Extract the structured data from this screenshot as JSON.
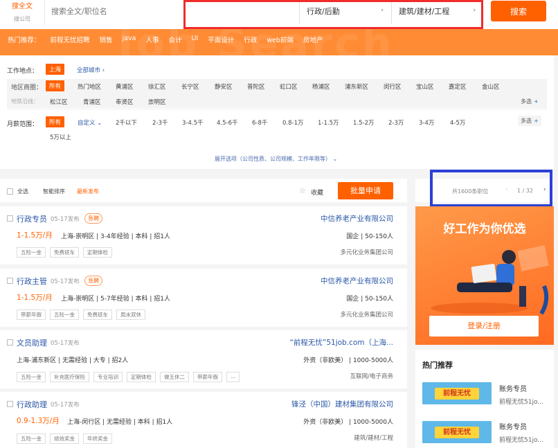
{
  "colors": {
    "accent": "#ff6000",
    "link": "#2b58a8",
    "highlight_red": "#ef2b2b",
    "highlight_blue": "#2b3fd6"
  },
  "search": {
    "type_active": "搜全文",
    "type_other": "搜公司",
    "placeholder": "搜索全文/职位名",
    "function_value": "行政/后勤",
    "industry_value": "建筑/建材/工程",
    "button": "搜索"
  },
  "hot": {
    "label": "热门推荐：",
    "items": [
      "前程无忧招聘",
      "销售",
      "java",
      "人事",
      "会计",
      "UI",
      "平面设计",
      "行政",
      "web前端",
      "房地产"
    ],
    "bg_text": "Job Search"
  },
  "filters": {
    "location_label": "工作地点：",
    "location_value": "上海",
    "all_cities": "全部城市",
    "area_label": "地区商圈：",
    "area_all": "所有",
    "areas_row1": [
      "热门地区",
      "黄浦区",
      "徐汇区",
      "长宁区",
      "静安区",
      "普陀区",
      "虹口区",
      "杨浦区",
      "浦东新区",
      "闵行区",
      "宝山区",
      "嘉定区",
      "金山区"
    ],
    "metro_label": "地铁沿线：",
    "areas_row2": [
      "松江区",
      "青浦区",
      "奉贤区",
      "崇明区"
    ],
    "multi": "多选",
    "salary_label": "月薪范围：",
    "salary_all": "所有",
    "salary_custom": "自定义",
    "salaries": [
      "2千以下",
      "2-3千",
      "3-4.5千",
      "4.5-6千",
      "6-8千",
      "0.8-1万",
      "1-1.5万",
      "1.5-2万",
      "2-3万",
      "3-4万",
      "4-5万"
    ],
    "salary_extra": "5万以上",
    "more": "展开选项（公司性质、公司规模、工作年限等）"
  },
  "list": {
    "select_all": "全选",
    "sort_smart": "智能排序",
    "sort_new": "最新发布",
    "fav": "收藏",
    "batch_apply": "批量申请",
    "total": "共1600条职位",
    "page": "1 / 32"
  },
  "jobs": [
    {
      "title": "行政专员",
      "date": "05-17发布",
      "urgent": "急聘",
      "company": "中信养老产业有限公司",
      "salary": "1-1.5万/月",
      "req": "上海-崇明区 | 3-4年经验 | 本科 | 招1人",
      "coinfo": "国企 | 50-150人",
      "tags": [
        "五险一金",
        "免费班车",
        "定期体检"
      ],
      "industry": "多元化业务集团公司"
    },
    {
      "title": "行政主管",
      "date": "05-17发布",
      "urgent": "急聘",
      "company": "中信养老产业有限公司",
      "salary": "1-1.5万/月",
      "req": "上海-崇明区 | 5-7年经验 | 本科 | 招1人",
      "coinfo": "国企 | 50-150人",
      "tags": [
        "带薪年假",
        "五险一金",
        "免费班车",
        "周末双休"
      ],
      "industry": "多元化业务集团公司"
    },
    {
      "title": "文员助理",
      "date": "05-17发布",
      "urgent": "",
      "company": "“前程无忧”51job.com（上海...",
      "salary": "",
      "req": "上海-浦东新区 | 无需经验 | 大专 | 招2人",
      "coinfo": "外资（非欧美） | 1000-5000人",
      "tags": [
        "五险一金",
        "补充医疗保险",
        "专业培训",
        "定期体检",
        "做五休二",
        "带薪年假",
        "..."
      ],
      "industry": "互联网/电子商务"
    },
    {
      "title": "行政助理",
      "date": "05-17发布",
      "urgent": "",
      "company": "锋泾（中国）建材集团有限公司",
      "salary": "0.9-1.3万/月",
      "req": "上海-闵行区 | 无需经验 | 本科 | 招1人",
      "coinfo": "外资（非欧美） | 1000-5000人",
      "tags": [
        "五险一金",
        "绩效奖金",
        "年终奖金"
      ],
      "industry": "建筑/建材/工程"
    }
  ],
  "promo": {
    "headline": "好工作为你优选",
    "login": "登录/注册"
  },
  "hot_rec": {
    "title": "热门推荐",
    "ads": [
      {
        "banner": "前程无忧",
        "job": "账务专员",
        "company": "前程无忧51jo..."
      },
      {
        "banner": "前程无忧",
        "job": "账务专员",
        "company": "前程无忧51jo..."
      }
    ]
  }
}
